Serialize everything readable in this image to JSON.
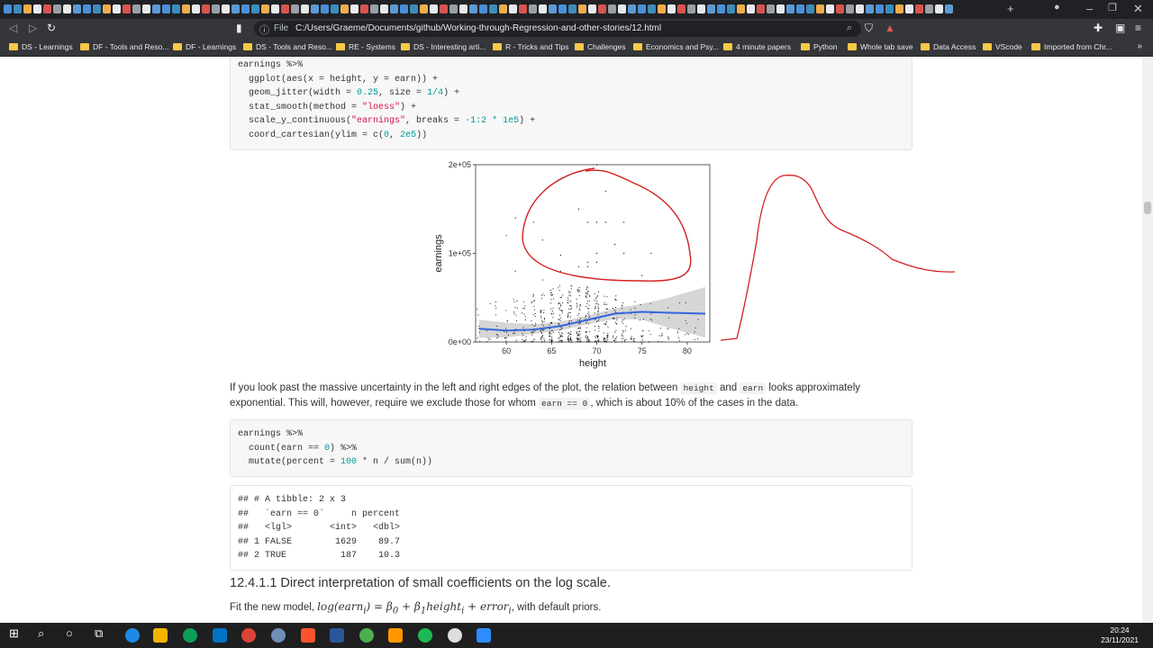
{
  "browser": {
    "url_scheme": "File",
    "url": "C:/Users/Graeme/Documents/github/Working-through-Regression-and-other-stories/12.html"
  },
  "bookmarks": [
    "DS - Learnings",
    "DF - Tools and Reso...",
    "DF - Learnings",
    "DS - Tools and Reso...",
    "RE - Systems",
    "DS - Interesting arti...",
    "R - Tricks and Tips",
    "Challenges",
    "Economics and Psy...",
    "4 minute papers",
    "Python",
    "Whole tab save",
    "Data Access",
    "VScode",
    "Imported from Chr..."
  ],
  "code1": {
    "l1": "earnings %>%",
    "l2a": "  ggplot(aes(x = height, y = earn)) +",
    "l3a": "  geom_jitter(width = ",
    "l3b": "0.25",
    "l3c": ", size = ",
    "l3d": "1/4",
    "l3e": ") +",
    "l4a": "  stat_smooth(method = ",
    "l4b": "\"loess\"",
    "l4c": ") +",
    "l5a": "  scale_y_continuous(",
    "l5b": "\"earnings\"",
    "l5c": ", breaks = ",
    "l5d": "-1:2 * 1e5",
    "l5e": ") +",
    "l6a": "  coord_cartesian(ylim = c(",
    "l6b": "0",
    "l6c": ", ",
    "l6d": "2e5",
    "l6e": "))"
  },
  "chart_data": {
    "type": "scatter",
    "xlabel": "height",
    "ylabel": "earnings",
    "xticks": [
      "60",
      "65",
      "70",
      "75",
      "80"
    ],
    "yticks": [
      "0e+00",
      "1e+05",
      "2e+05"
    ],
    "xlim": [
      56.6,
      82.5
    ],
    "ylim": [
      0,
      200000
    ],
    "smooth": {
      "x": [
        57,
        60,
        63,
        66,
        69,
        72,
        75,
        78,
        82
      ],
      "y": [
        15000,
        13000,
        14000,
        18000,
        25000,
        32000,
        34000,
        33000,
        32000
      ]
    },
    "band_upper": [
      25000,
      22000,
      20000,
      23000,
      30000,
      38000,
      43000,
      50000,
      62000
    ],
    "band_lower": [
      5000,
      5000,
      9000,
      13000,
      20000,
      26000,
      25000,
      16000,
      5000
    ],
    "points_high": [
      [
        70,
        200000
      ],
      [
        71,
        170000
      ],
      [
        68,
        150000
      ],
      [
        61,
        140000
      ],
      [
        63,
        135000
      ],
      [
        69,
        135000
      ],
      [
        70,
        135000
      ],
      [
        71,
        135000
      ],
      [
        73,
        135000
      ],
      [
        60,
        120000
      ],
      [
        64,
        115000
      ],
      [
        72,
        110000
      ],
      [
        70,
        100000
      ],
      [
        73,
        100000
      ],
      [
        76,
        100000
      ],
      [
        66,
        98000
      ],
      [
        69,
        90000
      ],
      [
        70,
        90000
      ],
      [
        68,
        85000
      ],
      [
        69,
        85000
      ],
      [
        61,
        80000
      ],
      [
        66,
        80000
      ],
      [
        75,
        75000
      ],
      [
        72,
        70000
      ],
      [
        64,
        70000
      ]
    ],
    "series_color": "#3366dd",
    "band_color": "#cccccc"
  },
  "para1": {
    "t1": "If you look past the massive uncertainty in the left and right edges of the plot, the relation between ",
    "c1": "height",
    "t2": " and ",
    "c2": "earn",
    "t3": " looks approximately exponential. This will, however, require we exclude those for whom ",
    "c3": "earn == 0",
    "t4": ", which is about 10% of the cases in the data."
  },
  "code2": {
    "l1": "earnings %>%",
    "l2a": "  count(earn == ",
    "l2b": "0",
    "l2c": ") %>%",
    "l3a": "  mutate(percent = ",
    "l3b": "100",
    "l3c": " * n / sum(n))"
  },
  "output": {
    "l1": "## # A tibble: 2 x 3",
    "l2": "##   `earn == 0`     n percent",
    "l3": "##   <lgl>       <int>   <dbl>",
    "l4": "## 1 FALSE        1629    89.7",
    "l5": "## 2 TRUE          187    10.3"
  },
  "section_title": "12.4.1.1 Direct interpretation of small coefficients on the log scale.",
  "para2": {
    "t1": "Fit the new model, ",
    "m1": "log(earn",
    "m1sub": "i",
    "m2": ") = β",
    "m2sub": "0",
    "m3": " + β",
    "m3sub": "1",
    "m4": "height",
    "m4sub": "i",
    "m5": " + error",
    "m5sub": "i",
    "t2": ", with default priors."
  },
  "clock": {
    "time": "20:24",
    "date": "23/11/2021"
  }
}
